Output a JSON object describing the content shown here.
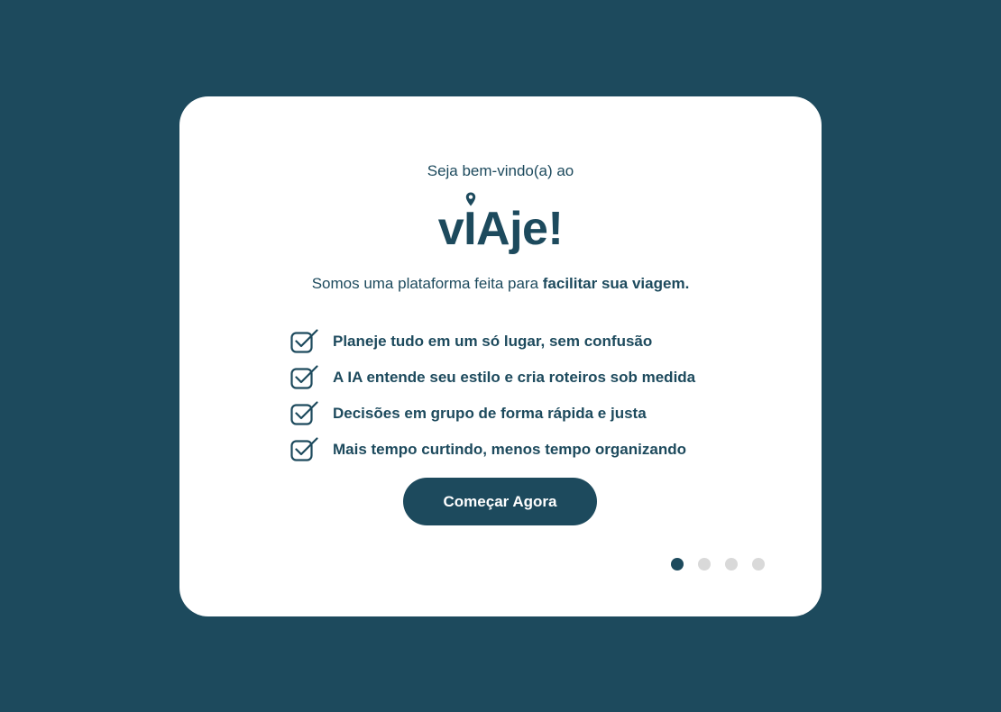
{
  "welcome_text": "Seja bem-vindo(a) ao",
  "logo": {
    "text": "vIAje!",
    "icon": "location-pin-icon"
  },
  "tagline": {
    "prefix": "Somos uma plataforma feita para ",
    "emphasis": "facilitar sua viagem."
  },
  "features": [
    {
      "icon": "checkbox-checked-icon",
      "label": "Planeje tudo em um só lugar, sem confusão"
    },
    {
      "icon": "checkbox-checked-icon",
      "label": "A IA entende seu estilo e cria roteiros sob medida"
    },
    {
      "icon": "checkbox-checked-icon",
      "label": "Decisões em grupo de forma rápida e justa"
    },
    {
      "icon": "checkbox-checked-icon",
      "label": "Mais tempo curtindo, menos tempo organizando"
    }
  ],
  "cta_label": "Começar Agora",
  "pagination": {
    "total": 4,
    "current": 1
  },
  "colors": {
    "background": "#1d4a5d",
    "card": "#ffffff",
    "primary": "#1d4a5d",
    "dot_inactive": "#d9d9d9"
  }
}
